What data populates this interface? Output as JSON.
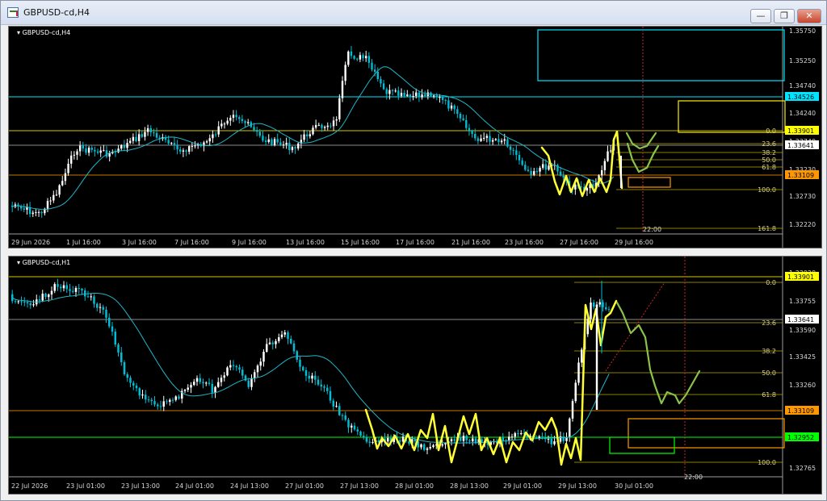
{
  "window": {
    "title": "GBPUSD-cd,H4",
    "buttons": {
      "minimize": "—",
      "restore": "❐",
      "close": "✕"
    }
  },
  "top_chart": {
    "label": "GBPUSD-cd,H4",
    "price_axis": [
      "1.35750",
      "1.35250",
      "1.34740",
      "1.34240",
      "1.33740",
      "1.33230",
      "1.32730",
      "1.32220"
    ],
    "price_tags": [
      {
        "text": "1.34526",
        "color": "#00e5ff"
      },
      {
        "text": "1.33901",
        "color": "#ffff00"
      },
      {
        "text": "1.33641",
        "color": "#ffffff"
      },
      {
        "text": "1.33109",
        "color": "#ff9800"
      }
    ],
    "fib_levels": [
      "0.0",
      "23.6",
      "38.2",
      "50.0",
      "61.8",
      "100.0",
      "161.8"
    ],
    "time_axis": [
      "29 Jun 2026",
      "1 Jul 16:00",
      "3 Jul 16:00",
      "7 Jul 16:00",
      "9 Jul 16:00",
      "13 Jul 16:00",
      "15 Jul 16:00",
      "17 Jul 16:00",
      "21 Jul 16:00",
      "23 Jul 16:00",
      "27 Jul 16:00",
      "29 Jul 16:00"
    ],
    "vline_label": "22:00"
  },
  "bottom_chart": {
    "label": "GBPUSD-cd,H1",
    "price_axis": [
      "1.33920",
      "1.33755",
      "1.33590",
      "1.33425",
      "1.33260",
      "1.32765"
    ],
    "price_tags": [
      {
        "text": "1.33901",
        "color": "#ffff00"
      },
      {
        "text": "1.33641",
        "color": "#ffffff"
      },
      {
        "text": "1.33109",
        "color": "#ff9800"
      },
      {
        "text": "1.32952",
        "color": "#00ff00"
      }
    ],
    "fib_levels": [
      "0.0",
      "23.6",
      "38.2",
      "50.0",
      "61.8",
      "100.0"
    ],
    "time_axis": [
      "22 Jul 2026",
      "23 Jul 01:00",
      "23 Jul 13:00",
      "24 Jul 01:00",
      "24 Jul 13:00",
      "27 Jul 01:00",
      "27 Jul 13:00",
      "28 Jul 01:00",
      "28 Jul 13:00",
      "29 Jul 01:00",
      "29 Jul 13:00",
      "30 Jul 01:00"
    ],
    "vline_label": "22:00"
  },
  "colors": {
    "bull": "#ffffff",
    "bear": "#00bcd4",
    "ma": "#1fb6c8",
    "yellow_drawing": "#ffff33",
    "green_drawing": "#8bc34a",
    "cyan_line": "#00e5ff",
    "orange_line": "#ff9800",
    "green_line": "#00ff00",
    "red_vline": "#c62828"
  }
}
